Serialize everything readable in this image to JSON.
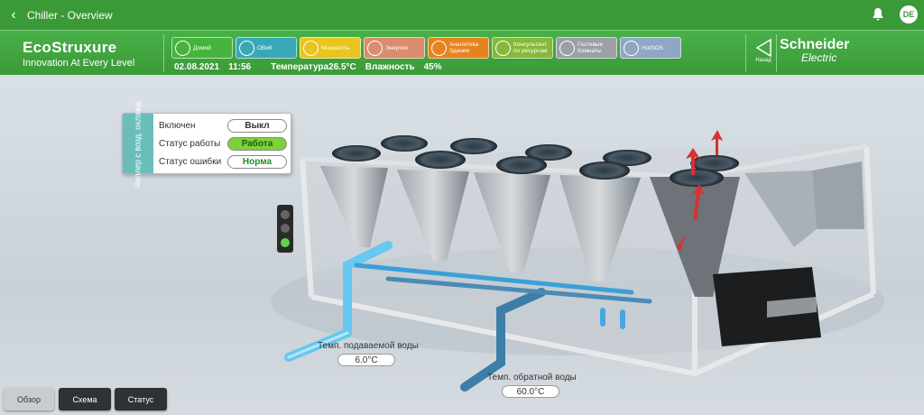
{
  "app": {
    "window_title": "Chiller - Overview",
    "user_initials": "DE"
  },
  "header": {
    "brand": "EcoStruxure",
    "tagline": "Innovation At Every Level",
    "date": "02.08.2021",
    "time": "11:56",
    "temperature_label": "Температура",
    "temperature_value": "26.5°C",
    "humidity_label": "Влажность",
    "humidity_value": "45%",
    "back_label": "Назад",
    "company_line1": "Schneider",
    "company_line2": "Electric",
    "tiles": [
      {
        "label": "Домой",
        "color": "#46b43c",
        "icon": "home-icon"
      },
      {
        "label": "ОВиК",
        "color": "#3aa7b8",
        "icon": "snowflake-icon"
      },
      {
        "label": "Мощность",
        "color": "#e8c51f",
        "icon": "power-icon"
      },
      {
        "label": "Энергия",
        "color": "#d98c6e",
        "icon": "energy-icon"
      },
      {
        "label": "Аналитика Здания",
        "color": "#e7831f",
        "icon": "analytics-icon"
      },
      {
        "label": "Консультант по ресурсам",
        "color": "#86b83a",
        "icon": "leaf-icon"
      },
      {
        "label": "Гостевые Комнаты",
        "color": "#9aa0a5",
        "icon": "bed-icon"
      },
      {
        "label": "HotSOS",
        "color": "#8fa6c4",
        "icon": "checklist-icon"
      }
    ]
  },
  "status_panel": {
    "side_title": "Чиллер с возд. охлажд.",
    "rows": [
      {
        "label": "Включен",
        "value": "Выкл",
        "value_color": "#333333",
        "bg": "#ffffff"
      },
      {
        "label": "Статус работы",
        "value": "Работа",
        "value_color": "#1f5e1f",
        "bg": "#7fd13a"
      },
      {
        "label": "Статус ошибки",
        "value": "Норма",
        "value_color": "#2a8a2a",
        "bg": "#ffffff"
      }
    ]
  },
  "traffic_light": {
    "active": "green",
    "green_color": "#5fd34a"
  },
  "sensors": {
    "supply_label": "Темп. подаваемой воды",
    "supply_value": "6.0°C",
    "return_label": "Темп. обратной воды",
    "return_value": "60.0°C"
  },
  "bottom_buttons": [
    {
      "label": "Обзор",
      "active": true
    },
    {
      "label": "Схема",
      "active": false
    },
    {
      "label": "Статус",
      "active": false
    }
  ]
}
